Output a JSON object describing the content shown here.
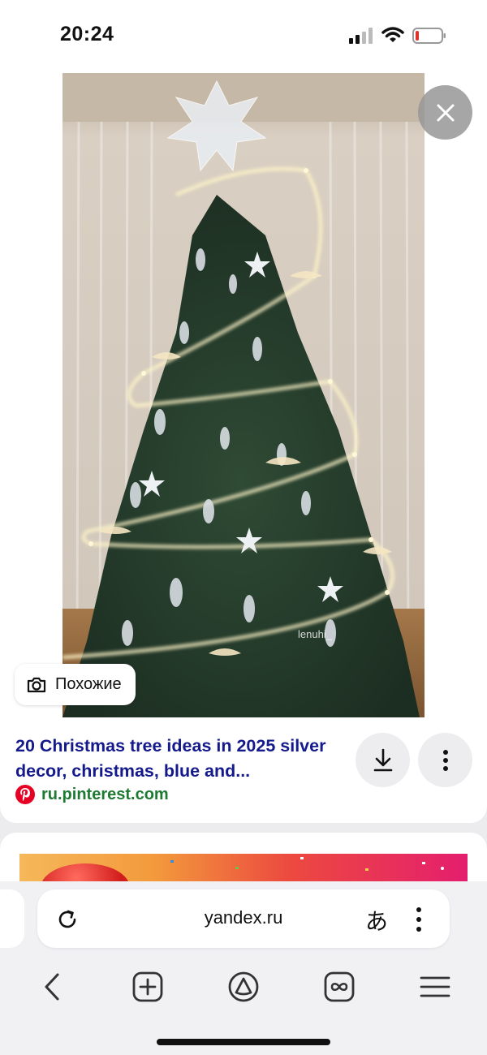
{
  "status_bar": {
    "time": "20:24"
  },
  "viewer": {
    "watermark": "lenuhi_",
    "similar_label": "Похожие"
  },
  "result": {
    "title": "20 Christmas tree ideas in 2025 silver decor, christmas, blue and...",
    "source": "ru.pinterest.com"
  },
  "address_bar": {
    "url": "yandex.ru",
    "translate_glyph": "あ"
  },
  "icons": {
    "close": "close-icon",
    "camera": "camera-icon",
    "download": "download-icon",
    "more": "more-vertical-icon",
    "reload": "reload-icon",
    "back": "back-arrow-icon",
    "new_tab": "plus-square-icon",
    "alice": "alice-assistant-icon",
    "tabs": "tabs-switcher-icon",
    "menu": "hamburger-menu-icon"
  },
  "colors": {
    "title_link": "#141a8c",
    "source_link": "#1e7a32",
    "pinterest": "#e60023"
  }
}
